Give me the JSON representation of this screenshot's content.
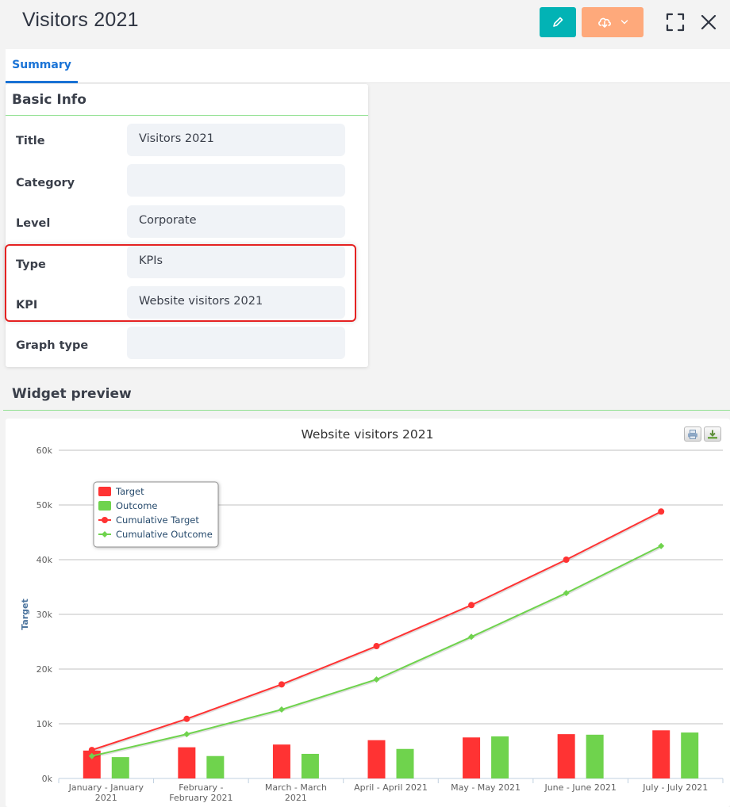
{
  "header": {
    "title": "Visitors 2021",
    "edit_icon": "pencil-icon",
    "download_icon": "cloud-download-icon",
    "dropdown_icon": "chevron-down-icon",
    "expand_icon": "fullscreen-icon",
    "close_icon": "close-icon",
    "edit_color": "#02b3b5",
    "download_color": "#fea97b"
  },
  "tabs": [
    {
      "label": "Summary",
      "active": true
    }
  ],
  "basic_info": {
    "title": "Basic Info",
    "fields": [
      {
        "label": "Title",
        "value": "Visitors 2021"
      },
      {
        "label": "Category",
        "value": ""
      },
      {
        "label": "Level",
        "value": "Corporate"
      },
      {
        "label": "Type",
        "value": "KPIs"
      },
      {
        "label": "KPI",
        "value": "Website visitors 2021"
      },
      {
        "label": "Graph type",
        "value": ""
      }
    ],
    "highlighted_fields": [
      "Type",
      "KPI"
    ]
  },
  "widget_preview": {
    "title": "Widget preview",
    "export_buttons": [
      "print-icon",
      "download-icon"
    ]
  },
  "chart_data": {
    "type": "bar",
    "title": "Website visitors 2021",
    "xlabel": "",
    "ylabel": "Target",
    "ylim": [
      0,
      60000
    ],
    "yticks": [
      0,
      10000,
      20000,
      30000,
      40000,
      50000,
      60000
    ],
    "ytick_labels": [
      "0k",
      "10k",
      "20k",
      "30k",
      "40k",
      "50k",
      "60k"
    ],
    "grid": true,
    "legend_position": "top-left",
    "categories": [
      [
        "January - January",
        "2021"
      ],
      [
        "February -",
        "February 2021"
      ],
      [
        "March - March",
        "2021"
      ],
      [
        "April - April 2021"
      ],
      [
        "May - May 2021"
      ],
      [
        "June - June 2021"
      ],
      [
        "July - July 2021"
      ]
    ],
    "series": [
      {
        "name": "Target",
        "kind": "bar",
        "color": "#ff3333",
        "values": [
          5100,
          5700,
          6200,
          7000,
          7500,
          8100,
          8800
        ]
      },
      {
        "name": "Outcome",
        "kind": "bar",
        "color": "#6fd34d",
        "values": [
          3900,
          4100,
          4500,
          5400,
          7700,
          8000,
          8400
        ]
      },
      {
        "name": "Cumulative Target",
        "kind": "line",
        "marker": "circle",
        "color": "#ff3333",
        "values": [
          5200,
          10900,
          17200,
          24200,
          31700,
          40000,
          48800
        ]
      },
      {
        "name": "Cumulative Outcome",
        "kind": "line",
        "marker": "diamond",
        "color": "#6fd34d",
        "values": [
          4100,
          8100,
          12600,
          18100,
          25900,
          33900,
          42500
        ]
      }
    ]
  }
}
